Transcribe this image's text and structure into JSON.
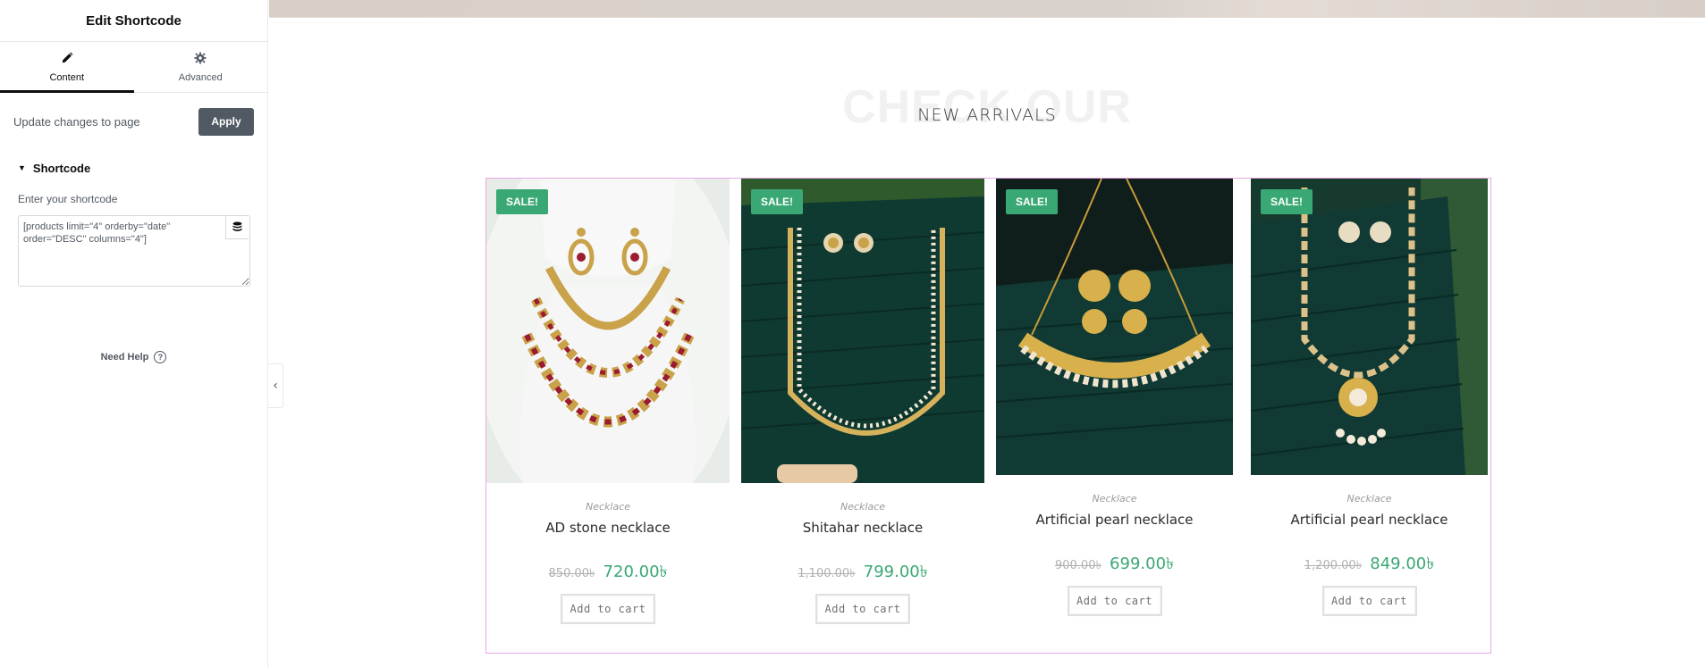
{
  "panel": {
    "title": "Edit Shortcode",
    "tabs": [
      {
        "label": "Content",
        "icon": "pencil-icon"
      },
      {
        "label": "Advanced",
        "icon": "gear-icon"
      }
    ],
    "update_text": "Update changes to page",
    "apply_label": "Apply",
    "section_label": "Shortcode",
    "field_label": "Enter your shortcode",
    "shortcode_value": "[products limit=\"4\" orderby=\"date\" order=\"DESC\" columns=\"4\"]",
    "need_help": "Need Help"
  },
  "page": {
    "bg_title": "CHECK OUR",
    "title": "NEW ARRIVALS",
    "sale_label": "SALE!",
    "add_to_cart": "Add to cart",
    "products": [
      {
        "category": "Necklace",
        "name": "AD stone necklace",
        "old_price": "850.00৳",
        "new_price": "720.00৳"
      },
      {
        "category": "Necklace",
        "name": "Shitahar necklace",
        "old_price": "1,100.00৳",
        "new_price": "799.00৳"
      },
      {
        "category": "Necklace",
        "name": "Artificial pearl necklace",
        "old_price": "900.00৳",
        "new_price": "699.00৳"
      },
      {
        "category": "Necklace",
        "name": "Artificial pearl necklace",
        "old_price": "1,200.00৳",
        "new_price": "849.00৳"
      }
    ]
  },
  "colors": {
    "sale_badge": "#3aa874",
    "price_new": "#3aa874",
    "apply_button": "#515962",
    "selection_outline": "#e6a9e3"
  }
}
